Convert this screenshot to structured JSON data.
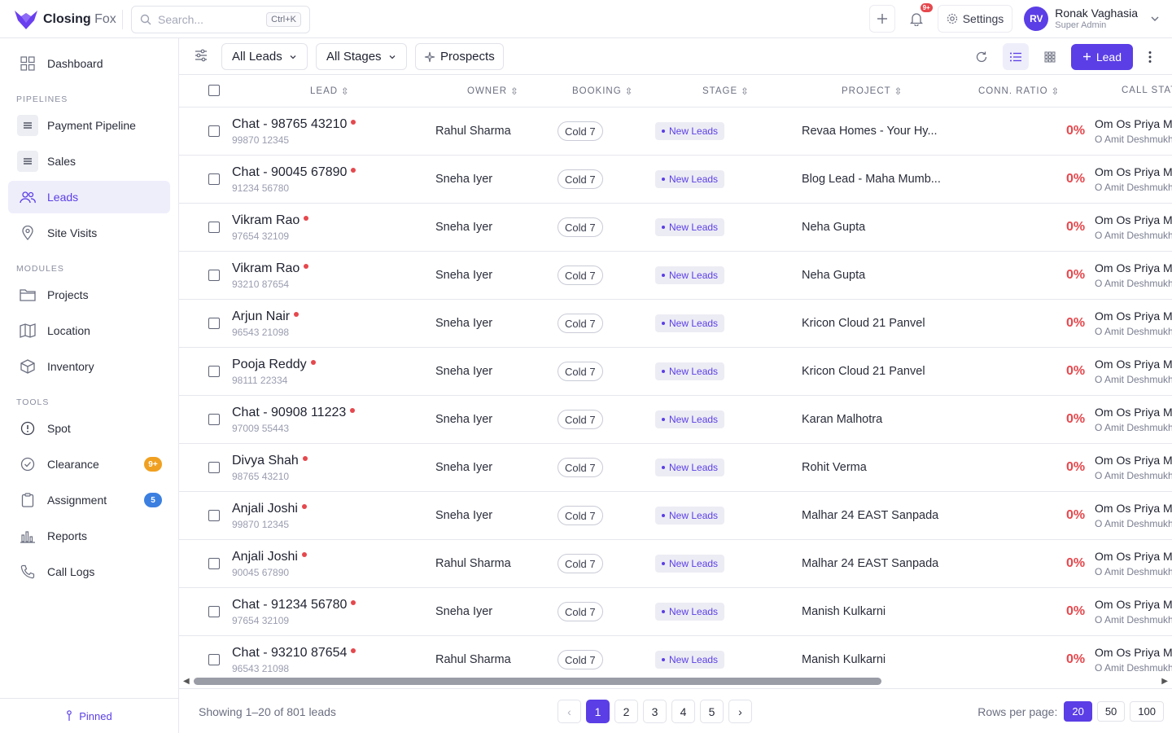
{
  "brand": {
    "name_bold": "Closing",
    "name_light": "Fox",
    "accent": "#5b3ee6"
  },
  "search": {
    "placeholder": "Search...",
    "shortcut": "Ctrl+K"
  },
  "header": {
    "notifications_badge": "9+",
    "settings_label": "Settings",
    "user": {
      "initials": "RV",
      "name": "Ronak Vaghasia",
      "role": "Super Admin"
    }
  },
  "sidebar": {
    "dashboard": "Dashboard",
    "sections": {
      "pipelines": "PIPELINES",
      "modules": "MODULES",
      "tools": "TOOLS"
    },
    "pipelines": [
      "Payment Pipeline",
      "Sales"
    ],
    "leads": "Leads",
    "site_visits": "Site Visits",
    "modules": [
      "Projects",
      "Location",
      "Inventory"
    ],
    "tools": [
      {
        "label": "Spot",
        "badge": ""
      },
      {
        "label": "Clearance",
        "badge": "9+",
        "badge_color": "#f0a020"
      },
      {
        "label": "Assignment",
        "badge": "5",
        "badge_color": "#3b7fe0"
      },
      {
        "label": "Reports",
        "badge": ""
      },
      {
        "label": "Call Logs",
        "badge": ""
      }
    ],
    "pinned": "Pinned"
  },
  "toolbar": {
    "leads_filter": "All Leads",
    "stages_filter": "All Stages",
    "prospects": "Prospects",
    "add_lead": "Lead"
  },
  "table": {
    "columns": [
      "LEAD",
      "OWNER",
      "BOOKING",
      "STAGE",
      "PROJECT",
      "CONN. RATIO",
      "CALL STAT"
    ],
    "rows": [
      {
        "name": "Chat - 98765 43210",
        "phone": "99870 12345",
        "owner": "Rahul Sharma",
        "booking": "Cold 7",
        "stage": "New Leads",
        "project": "Revaa Homes - Your Hy...",
        "ratio": "0%",
        "call_primary": "Om Os Priya M",
        "call_secondary": "O Amit Deshmukh"
      },
      {
        "name": "Chat - 90045 67890",
        "phone": "91234 56780",
        "owner": "Sneha Iyer",
        "booking": "Cold 7",
        "stage": "New Leads",
        "project": "Blog Lead - Maha Mumb...",
        "ratio": "0%",
        "call_primary": "Om Os Priya M",
        "call_secondary": "O Amit Deshmukh"
      },
      {
        "name": "Vikram Rao",
        "phone": "97654 32109",
        "owner": "Sneha Iyer",
        "booking": "Cold 7",
        "stage": "New Leads",
        "project": "Neha Gupta",
        "ratio": "0%",
        "call_primary": "Om Os Priya M",
        "call_secondary": "O Amit Deshmukh"
      },
      {
        "name": "Vikram Rao",
        "phone": "93210 87654",
        "owner": "Sneha Iyer",
        "booking": "Cold 7",
        "stage": "New Leads",
        "project": "Neha Gupta",
        "ratio": "0%",
        "call_primary": "Om Os Priya M",
        "call_secondary": "O Amit Deshmukh"
      },
      {
        "name": "Arjun Nair",
        "phone": "96543 21098",
        "owner": "Sneha Iyer",
        "booking": "Cold 7",
        "stage": "New Leads",
        "project": "Kricon Cloud 21 Panvel",
        "ratio": "0%",
        "call_primary": "Om Os Priya M",
        "call_secondary": "O Amit Deshmukh"
      },
      {
        "name": "Pooja Reddy",
        "phone": "98111 22334",
        "owner": "Sneha Iyer",
        "booking": "Cold 7",
        "stage": "New Leads",
        "project": "Kricon Cloud 21 Panvel",
        "ratio": "0%",
        "call_primary": "Om Os Priya M",
        "call_secondary": "O Amit Deshmukh"
      },
      {
        "name": "Chat - 90908 11223",
        "phone": "97009 55443",
        "owner": "Sneha Iyer",
        "booking": "Cold 7",
        "stage": "New Leads",
        "project": "Karan Malhotra",
        "ratio": "0%",
        "call_primary": "Om Os Priya M",
        "call_secondary": "O Amit Deshmukh"
      },
      {
        "name": "Divya Shah",
        "phone": "98765 43210",
        "owner": "Sneha Iyer",
        "booking": "Cold 7",
        "stage": "New Leads",
        "project": "Rohit Verma",
        "ratio": "0%",
        "call_primary": "Om Os Priya M",
        "call_secondary": "O Amit Deshmukh"
      },
      {
        "name": "Anjali Joshi",
        "phone": "99870 12345",
        "owner": "Sneha Iyer",
        "booking": "Cold 7",
        "stage": "New Leads",
        "project": "Malhar 24 EAST Sanpada",
        "ratio": "0%",
        "call_primary": "Om Os Priya M",
        "call_secondary": "O Amit Deshmukh"
      },
      {
        "name": "Anjali Joshi",
        "phone": "90045 67890",
        "owner": "Rahul Sharma",
        "booking": "Cold 7",
        "stage": "New Leads",
        "project": "Malhar 24 EAST Sanpada",
        "ratio": "0%",
        "call_primary": "Om Os Priya M",
        "call_secondary": "O Amit Deshmukh"
      },
      {
        "name": "Chat - 91234 56780",
        "phone": "97654 32109",
        "owner": "Sneha Iyer",
        "booking": "Cold 7",
        "stage": "New Leads",
        "project": "Manish Kulkarni",
        "ratio": "0%",
        "call_primary": "Om Os Priya M",
        "call_secondary": "O Amit Deshmukh"
      },
      {
        "name": "Chat - 93210 87654",
        "phone": "96543 21098",
        "owner": "Rahul Sharma",
        "booking": "Cold 7",
        "stage": "New Leads",
        "project": "Manish Kulkarni",
        "ratio": "0%",
        "call_primary": "Om Os Priya M",
        "call_secondary": "O Amit Deshmukh"
      }
    ]
  },
  "footer": {
    "showing": "Showing 1–20 of 801 leads",
    "pages": [
      "1",
      "2",
      "3",
      "4",
      "5"
    ],
    "prev": "‹",
    "next": "›",
    "rows_per_page_label": "Rows per page:",
    "rows_per_page_options": [
      "20",
      "50",
      "100"
    ]
  }
}
